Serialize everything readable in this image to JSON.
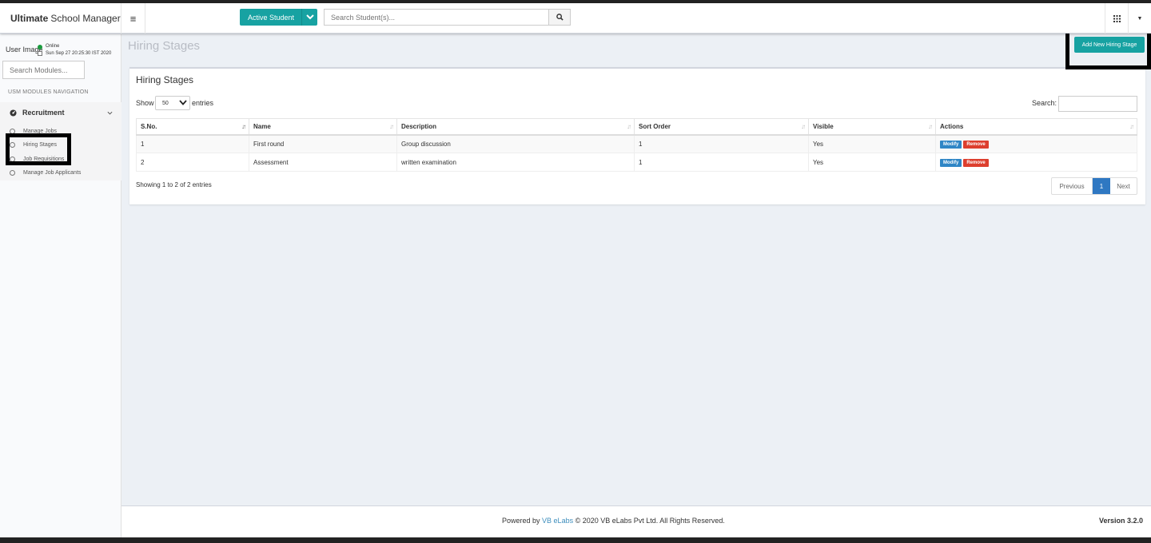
{
  "header": {
    "brand_bold": "Ultimate",
    "brand_rest": "School Manager",
    "active_student_label": "Active Student",
    "student_search_placeholder": "Search Student(s)..."
  },
  "sidebar": {
    "user_image_alt": "User Image",
    "status": "Online",
    "datetime": "Sun Sep 27 20:25:30 IST 2020",
    "module_search_placeholder": "Search Modules...",
    "nav_header": "USM MODULES NAVIGATION",
    "group_label": "Recruitment",
    "items": [
      {
        "label": "Manage Jobs"
      },
      {
        "label": "Hiring Stages"
      },
      {
        "label": "Job Requisitions"
      },
      {
        "label": "Manage Job Applicants"
      }
    ]
  },
  "main": {
    "page_title": "Hiring Stages",
    "add_button": "Add New Hiring Stage",
    "box_title": "Hiring Stages",
    "show_label": "Show",
    "page_length": "50",
    "entries_label": "entries",
    "search_label": "Search:",
    "columns": [
      "S.No.",
      "Name",
      "Description",
      "Sort Order",
      "Visible",
      "Actions"
    ],
    "rows": [
      {
        "sno": "1",
        "name": "First round",
        "description": "Group discussion",
        "sort_order": "1",
        "visible": "Yes",
        "modify": "Modify",
        "remove": "Remove"
      },
      {
        "sno": "2",
        "name": "Assessment",
        "description": "written examination",
        "sort_order": "1",
        "visible": "Yes",
        "modify": "Modify",
        "remove": "Remove"
      }
    ],
    "info": "Showing 1 to 2 of 2 entries",
    "pager": {
      "previous": "Previous",
      "current": "1",
      "next": "Next"
    }
  },
  "footer": {
    "powered_by": "Powered by",
    "company_link": "VB eLabs",
    "copyright": "© 2020 VB eLabs Pvt Ltd. All Rights Reserved.",
    "version": "Version 3.2.0"
  },
  "colors": {
    "accent": "#17a2a2",
    "primary": "#2f78c2",
    "danger": "#dd3f2e",
    "background": "#ecf0f5"
  }
}
